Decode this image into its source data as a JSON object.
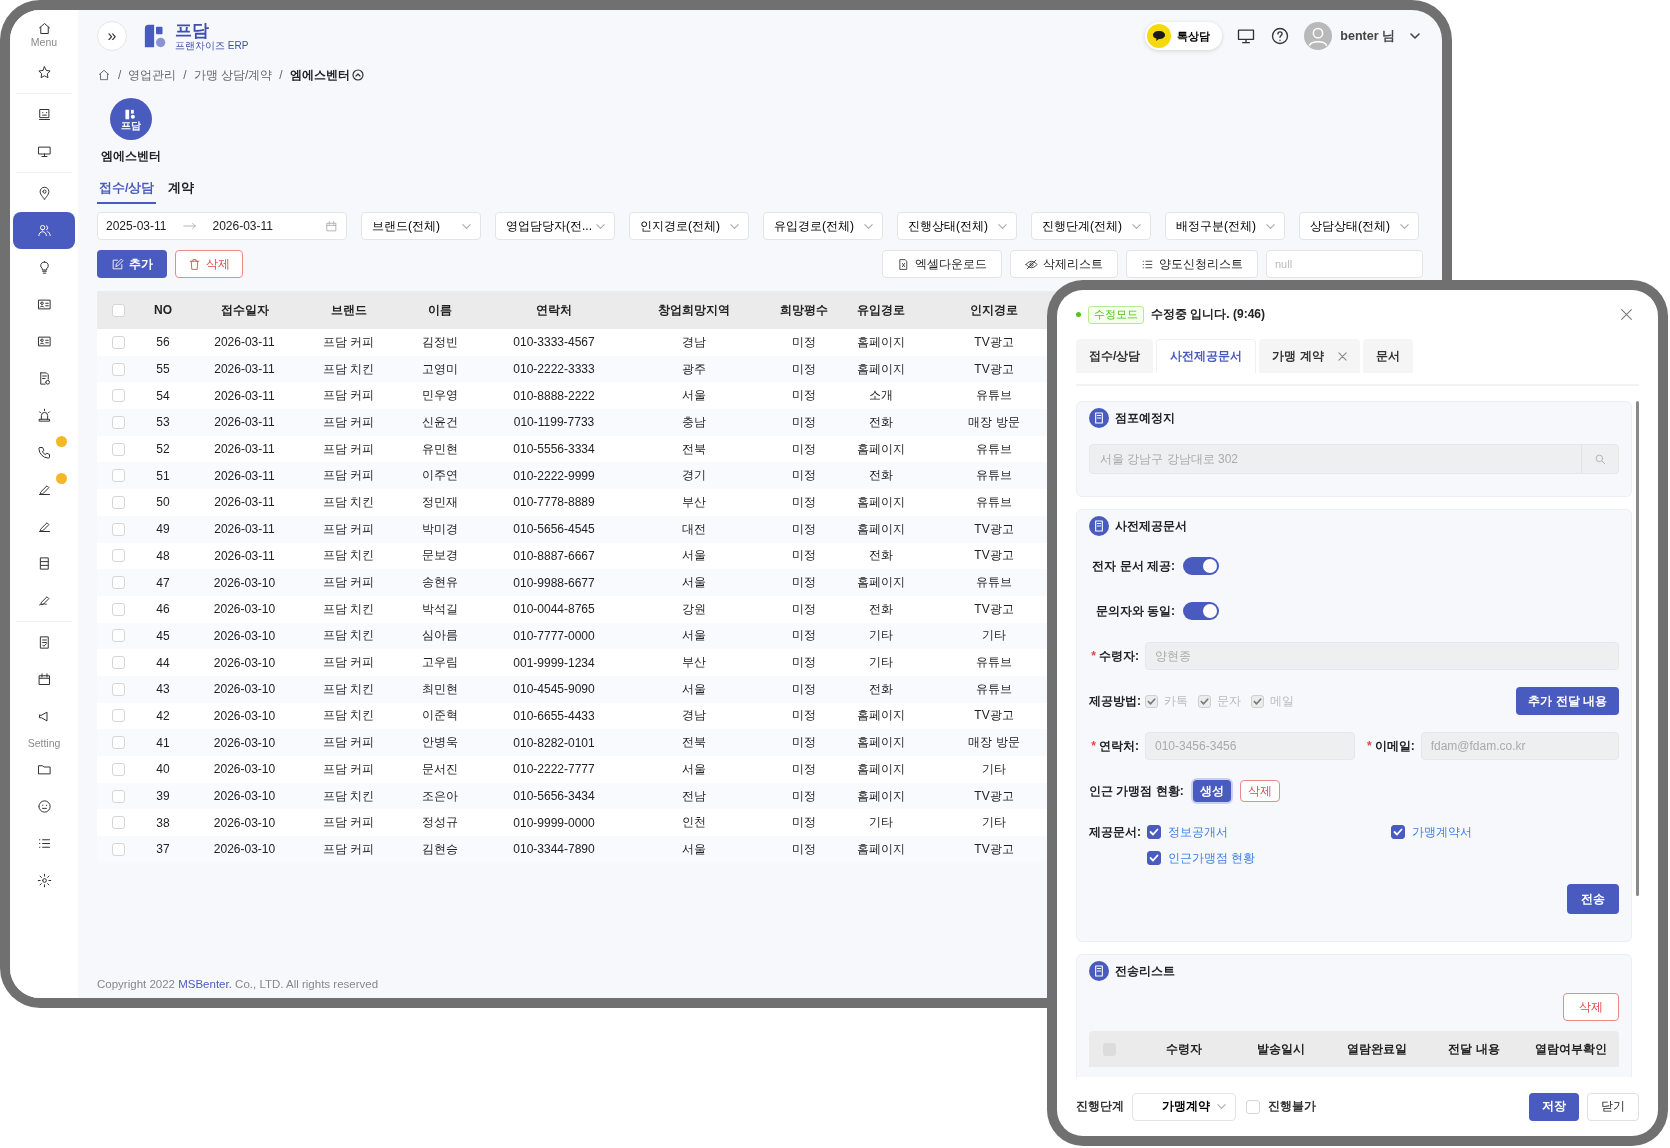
{
  "sidebar": {
    "groups": [
      {
        "items": [
          {
            "label": "Menu",
            "selected": false,
            "badge": false
          },
          {
            "selected": false,
            "badge": false
          }
        ]
      },
      {
        "items": [
          {
            "selected": false,
            "badge": false
          },
          {
            "selected": false,
            "badge": false
          }
        ]
      },
      {
        "items": [
          {
            "selected": false,
            "badge": false
          },
          {
            "selected": true,
            "badge": false
          },
          {
            "selected": false,
            "badge": false
          },
          {
            "selected": false,
            "badge": false
          },
          {
            "selected": false,
            "badge": false
          },
          {
            "selected": false,
            "badge": false
          },
          {
            "selected": false,
            "badge": false
          },
          {
            "selected": false,
            "badge": true
          },
          {
            "selected": false,
            "badge": true
          },
          {
            "selected": false,
            "badge": false
          },
          {
            "selected": false,
            "badge": false
          },
          {
            "selected": false,
            "badge": false
          }
        ]
      },
      {
        "items": [
          {
            "selected": false,
            "badge": false
          },
          {
            "selected": false,
            "badge": false
          },
          {
            "selected": false,
            "badge": false
          }
        ]
      },
      {
        "title": "Setting",
        "items": [
          {
            "selected": false,
            "badge": false
          },
          {
            "selected": false,
            "badge": false
          },
          {
            "selected": false,
            "badge": false
          },
          {
            "selected": false,
            "badge": false
          }
        ]
      }
    ]
  },
  "header": {
    "expand_button": "»",
    "brand": "프담",
    "brand_sub": "프랜차이즈 ERP",
    "chat_button": "톡상담",
    "user": "benter 님"
  },
  "breadcrumb": [
    {
      "separator": "/",
      "label": "영업관리"
    },
    {
      "separator": "/",
      "label": "가맹 상담/계약"
    },
    {
      "separator": "/",
      "label": "엠에스벤터"
    }
  ],
  "company": {
    "logo_text": "프담",
    "name": "엠에스벤터"
  },
  "tabs": [
    {
      "label": "접수/상담",
      "selected": true
    },
    {
      "label": "계약",
      "selected": false
    }
  ],
  "filters": {
    "date_from": "2025-03-11",
    "date_to": "2026-03-11",
    "selects": [
      "브랜드(전체)",
      "영업담당자(전...",
      "인지경로(전체)",
      "유입경로(전체)",
      "진행상태(전체)",
      "진행단계(전체)",
      "배정구분(전체)",
      "상담상태(전체)"
    ]
  },
  "actions": {
    "add_button": "추가",
    "delete_button": "삭제",
    "excel_button": "엑셀다운로드",
    "deleted_list_button": "삭제리스트",
    "transfer_list_button": "양도신청리스트",
    "search_placeholder": "null"
  },
  "table": {
    "all_selected": false,
    "columns": [
      "NO",
      "접수일자",
      "브랜드",
      "이름",
      "연락처",
      "창업희망지역",
      "희망평수",
      "유입경로",
      "인지경로"
    ],
    "rows": [
      {
        "selected": false,
        "cells": [
          "56",
          "2026-03-11",
          "프담 커피",
          "김정빈",
          "010-3333-4567",
          "경남",
          "미정",
          "홈페이지",
          "TV광고"
        ]
      },
      {
        "selected": false,
        "cells": [
          "55",
          "2026-03-11",
          "프담 치킨",
          "고영미",
          "010-2222-3333",
          "광주",
          "미정",
          "홈페이지",
          "TV광고"
        ]
      },
      {
        "selected": false,
        "cells": [
          "54",
          "2026-03-11",
          "프담 커피",
          "민우영",
          "010-8888-2222",
          "서울",
          "미정",
          "소개",
          "유튜브"
        ]
      },
      {
        "selected": false,
        "cells": [
          "53",
          "2026-03-11",
          "프담 커피",
          "신윤건",
          "010-1199-7733",
          "충남",
          "미정",
          "전화",
          "매장 방문"
        ]
      },
      {
        "selected": false,
        "cells": [
          "52",
          "2026-03-11",
          "프담 커피",
          "유민현",
          "010-5556-3334",
          "전북",
          "미정",
          "홈페이지",
          "유튜브"
        ]
      },
      {
        "selected": false,
        "cells": [
          "51",
          "2026-03-11",
          "프담 커피",
          "이주연",
          "010-2222-9999",
          "경기",
          "미정",
          "전화",
          "유튜브"
        ]
      },
      {
        "selected": false,
        "cells": [
          "50",
          "2026-03-11",
          "프담 치킨",
          "정민재",
          "010-7778-8889",
          "부산",
          "미정",
          "홈페이지",
          "유튜브"
        ]
      },
      {
        "selected": false,
        "cells": [
          "49",
          "2026-03-11",
          "프담 커피",
          "박미경",
          "010-5656-4545",
          "대전",
          "미정",
          "홈페이지",
          "TV광고"
        ]
      },
      {
        "selected": false,
        "cells": [
          "48",
          "2026-03-11",
          "프담 치킨",
          "문보경",
          "010-8887-6667",
          "서울",
          "미정",
          "전화",
          "TV광고"
        ]
      },
      {
        "selected": false,
        "cells": [
          "47",
          "2026-03-10",
          "프담 커피",
          "송현유",
          "010-9988-6677",
          "서울",
          "미정",
          "홈페이지",
          "유튜브"
        ]
      },
      {
        "selected": false,
        "cells": [
          "46",
          "2026-03-10",
          "프담 치킨",
          "박석길",
          "010-0044-8765",
          "강원",
          "미정",
          "전화",
          "TV광고"
        ]
      },
      {
        "selected": false,
        "cells": [
          "45",
          "2026-03-10",
          "프담 치킨",
          "심아름",
          "010-7777-0000",
          "서울",
          "미정",
          "기타",
          "기타"
        ]
      },
      {
        "selected": false,
        "cells": [
          "44",
          "2026-03-10",
          "프담 커피",
          "고우림",
          "001-9999-1234",
          "부산",
          "미정",
          "기타",
          "유튜브"
        ]
      },
      {
        "selected": false,
        "cells": [
          "43",
          "2026-03-10",
          "프담 치킨",
          "최민현",
          "010-4545-9090",
          "서울",
          "미정",
          "전화",
          "유튜브"
        ]
      },
      {
        "selected": false,
        "cells": [
          "42",
          "2026-03-10",
          "프담 치킨",
          "이준혁",
          "010-6655-4433",
          "경남",
          "미정",
          "홈페이지",
          "TV광고"
        ]
      },
      {
        "selected": false,
        "cells": [
          "41",
          "2026-03-10",
          "프담 커피",
          "안병욱",
          "010-8282-0101",
          "전북",
          "미정",
          "홈페이지",
          "매장 방문"
        ]
      },
      {
        "selected": false,
        "cells": [
          "40",
          "2026-03-10",
          "프담 커피",
          "문서진",
          "010-2222-7777",
          "서울",
          "미정",
          "홈페이지",
          "기타"
        ]
      },
      {
        "selected": false,
        "cells": [
          "39",
          "2026-03-10",
          "프담 치킨",
          "조은아",
          "010-5656-3434",
          "전남",
          "미정",
          "홈페이지",
          "TV광고"
        ]
      },
      {
        "selected": false,
        "cells": [
          "38",
          "2026-03-10",
          "프담 커피",
          "정성규",
          "010-9999-0000",
          "인천",
          "미정",
          "기타",
          "기타"
        ]
      },
      {
        "selected": false,
        "cells": [
          "37",
          "2026-03-10",
          "프담 커피",
          "김현승",
          "010-3344-7890",
          "서울",
          "미정",
          "홈페이지",
          "TV광고"
        ]
      }
    ]
  },
  "footer": {
    "copyright": "Copyright 2022 **MSBenter.** Co., LTD. All rights reserved"
  },
  "modal": {
    "mode_badge": "수정모드",
    "status": "수정중 입니다. (9:46)",
    "tabs": [
      {
        "label": "접수/상담",
        "selected": false,
        "closable": false
      },
      {
        "label": "사전제공문서",
        "selected": true,
        "closable": false
      },
      {
        "label": "가맹 계약",
        "selected": false,
        "closable": true
      },
      {
        "label": "문서",
        "selected": false,
        "closable": false
      }
    ],
    "site_panel": {
      "title": "점포예정지",
      "address": "서울 강남구 강남대로 302",
      "disabled": true
    },
    "docs_panel": {
      "title": "사전제공문서",
      "toggles": [
        {
          "label": "전자 문서 제공:",
          "on": true
        },
        {
          "label": "문의자와 동일:",
          "on": true
        }
      ],
      "recipient": {
        "label": "수령자:",
        "required_mark": "*",
        "value": "양현종",
        "disabled": true
      },
      "methods": {
        "label": "제공방법:",
        "options": [
          {
            "label": "카톡",
            "checked": true,
            "disabled": true
          },
          {
            "label": "문자",
            "checked": true,
            "disabled": true
          },
          {
            "label": "메일",
            "checked": true,
            "disabled": true
          }
        ]
      },
      "extra_button": "추가 전달 내용",
      "contact": {
        "label": "연락처:",
        "required_mark": "*",
        "value": "010-3456-3456",
        "disabled": true
      },
      "email": {
        "label": "이메일:",
        "required_mark": "*",
        "value": "fdam@fdam.co.kr",
        "disabled": true
      },
      "nearby": {
        "label": "인근 가맹점 현황:",
        "create_button": "생성",
        "delete_button": "삭제"
      },
      "documents": {
        "label": "제공문서:",
        "options": [
          {
            "label": "정보공개서",
            "checked": true
          },
          {
            "label": "가맹계약서",
            "checked": true
          },
          {
            "label": "인근가맹점 현황",
            "checked": true
          }
        ]
      },
      "send_button": "전송"
    },
    "send_panel": {
      "title": "전송리스트",
      "delete_button": "삭제",
      "all_selected": false,
      "columns": [
        "수령자",
        "발송일시",
        "열람완료일",
        "전달 내용",
        "열람여부확인"
      ]
    },
    "footer": {
      "stage_label": "진행단계",
      "stage_value": "가맹계약",
      "blocked": {
        "label": "진행불가",
        "checked": false
      },
      "save_button": "저장",
      "close_button": "닫기"
    }
  }
}
